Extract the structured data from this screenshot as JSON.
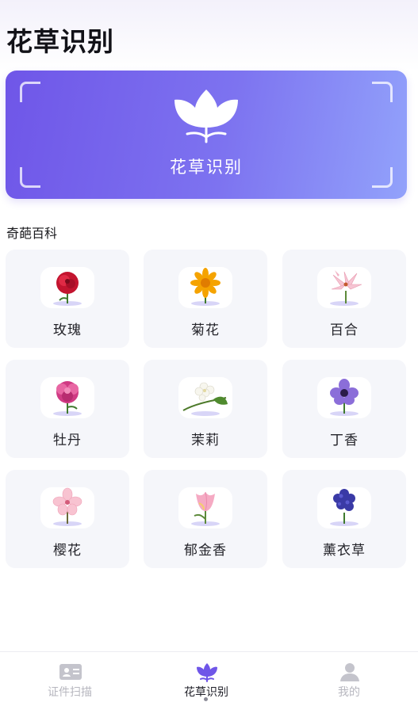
{
  "header": {
    "title": "花草识别"
  },
  "hero": {
    "label": "花草识别",
    "icon": "tulip-icon"
  },
  "section": {
    "title": "奇葩百科"
  },
  "flowers": [
    {
      "name": "玫瑰",
      "icon": "rose-icon",
      "color": "#d81b3a"
    },
    {
      "name": "菊花",
      "icon": "chrysanthemum-icon",
      "color": "#f5a300"
    },
    {
      "name": "百合",
      "icon": "lily-icon",
      "color": "#f3b7c8"
    },
    {
      "name": "牡丹",
      "icon": "peony-icon",
      "color": "#c8307a"
    },
    {
      "name": "茉莉",
      "icon": "jasmine-icon",
      "color": "#f2f2ea"
    },
    {
      "name": "丁香",
      "icon": "lilac-icon",
      "color": "#8a6ad8"
    },
    {
      "name": "樱花",
      "icon": "cherry-blossom-icon",
      "color": "#f6bccb"
    },
    {
      "name": "郁金香",
      "icon": "tulip-flower-icon",
      "color": "#f4a9c1"
    },
    {
      "name": "薰衣草",
      "icon": "lavender-icon",
      "color": "#3b3aa8"
    }
  ],
  "tabs": [
    {
      "label": "证件扫描",
      "icon": "id-card-icon"
    },
    {
      "label": "花草识别",
      "icon": "tulip-icon",
      "active": true
    },
    {
      "label": "我的",
      "icon": "user-icon"
    }
  ],
  "colors": {
    "accent": "#6f56e8",
    "card_bg": "#f5f6fa"
  }
}
